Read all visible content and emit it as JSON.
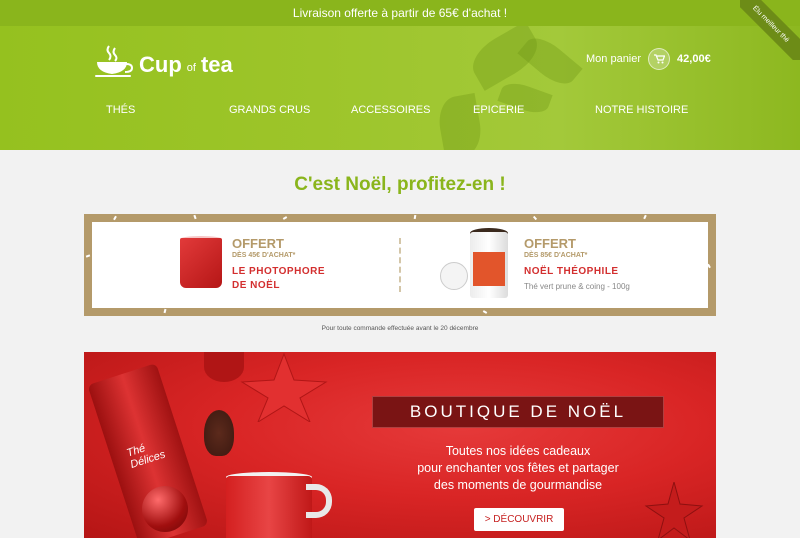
{
  "topbar": {
    "text": "Livraison offerte à partir de 65€ d'achat !"
  },
  "corner_badge": {
    "text": "Élu meilleur thé"
  },
  "header": {
    "logo": {
      "cup": "Cup",
      "of": "of",
      "tea": "tea"
    },
    "cart": {
      "label": "Mon panier",
      "amount": "42,00€"
    },
    "nav": [
      "THÉS",
      "GRANDS CRUS",
      "ACCESSOIRES",
      "EPICERIE",
      "NOTRE HISTOIRE"
    ]
  },
  "promo": {
    "title": "C'est Noël, profitez-en !"
  },
  "offers": [
    {
      "head": "OFFERT",
      "sub": "DÈS 45€ D'ACHAT*",
      "name_line1": "LE PHOTOPHORE",
      "name_line2": "DE NOËL",
      "desc": ""
    },
    {
      "head": "OFFERT",
      "sub": "DÈS 85€ D'ACHAT*",
      "name_line1": "NOËL THÉOPHILE",
      "name_line2": "",
      "desc": "Thé vert prune & coing - 100g"
    }
  ],
  "footnote": "Pour toute commande effectuée avant le 20 décembre",
  "banner": {
    "title": "BOUTIQUE DE NOËL",
    "line1": "Toutes nos idées cadeaux",
    "line2": "pour enchanter vos fêtes et partager",
    "line3": "des moments de gourmandise",
    "button": "> DÉCOUVRIR",
    "tube_label_1": "Thé",
    "tube_label_2": "Délices"
  },
  "colors": {
    "brand_green": "#8ab51c",
    "gold": "#b49a6a",
    "red": "#d32f2f"
  },
  "icons": [
    "cup-logo-icon",
    "cart-icon",
    "star-ornament-icon"
  ]
}
